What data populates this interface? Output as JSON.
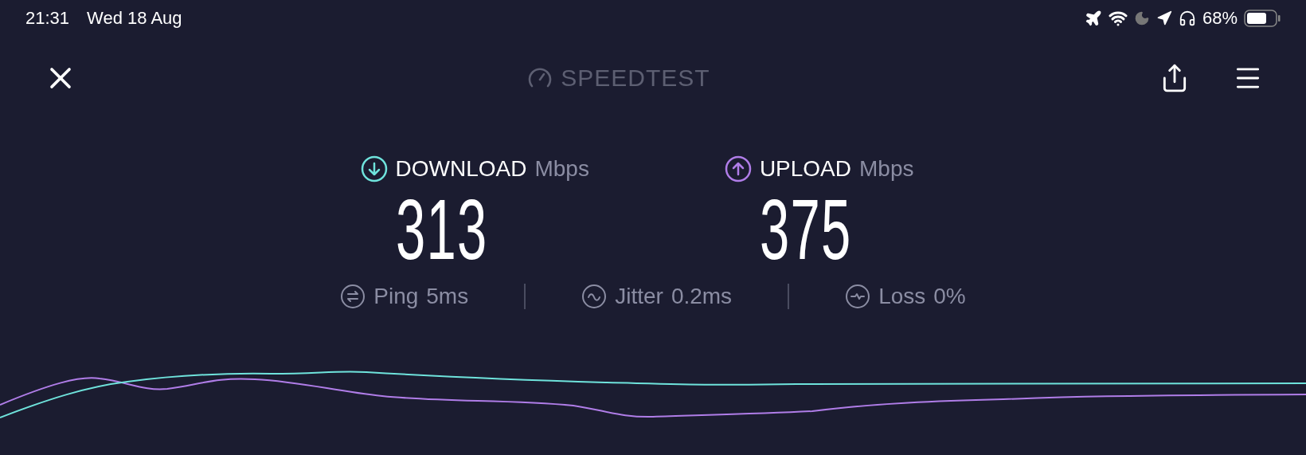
{
  "status_bar": {
    "time": "21:31",
    "date": "Wed 18 Aug",
    "battery": "68%"
  },
  "header": {
    "logo": "SPEEDTEST"
  },
  "metrics": [
    {
      "kind": "download",
      "label": "DOWNLOAD",
      "unit": "Mbps",
      "value": "313",
      "color": "#6fe3dc"
    },
    {
      "kind": "upload",
      "label": "UPLOAD",
      "unit": "Mbps",
      "value": "375",
      "color": "#b07de8"
    }
  ],
  "stats": [
    {
      "kind": "ping",
      "label": "Ping",
      "value": "5ms"
    },
    {
      "kind": "jitter",
      "label": "Jitter",
      "value": "0.2ms"
    },
    {
      "kind": "loss",
      "label": "Loss",
      "value": "0%"
    }
  ]
}
